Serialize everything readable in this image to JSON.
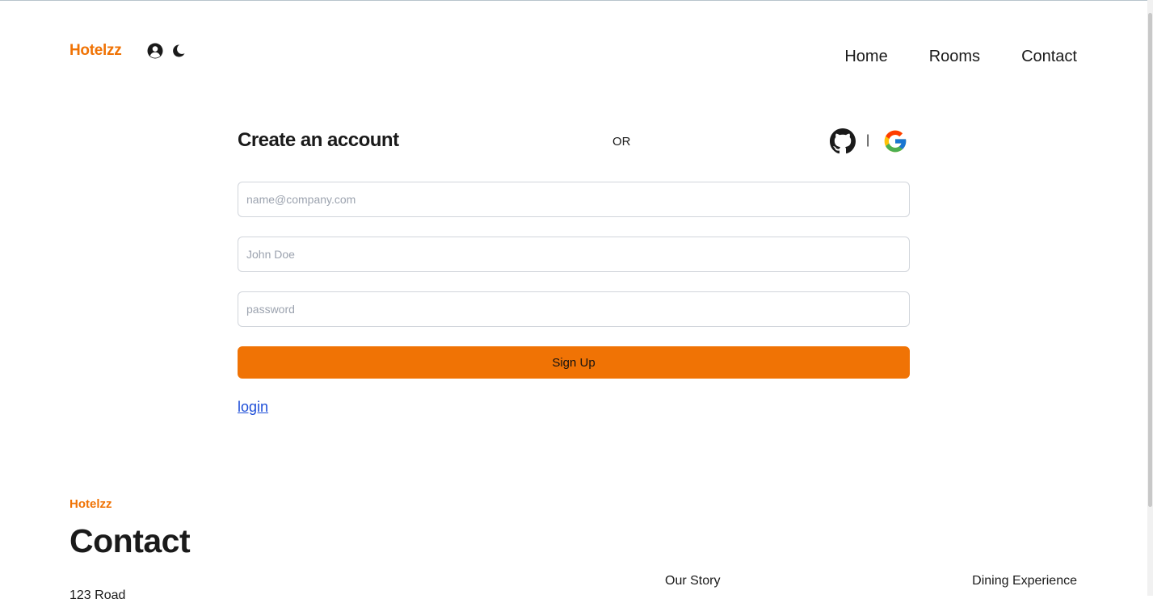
{
  "header": {
    "brand": "Hotelzz",
    "nav": [
      "Home",
      "Rooms",
      "Contact"
    ]
  },
  "signup": {
    "title": "Create an account",
    "or_label": "OR",
    "separator": "|",
    "email_placeholder": "name@company.com",
    "name_placeholder": "John Doe",
    "password_placeholder": "password",
    "submit_label": "Sign Up",
    "login_link": "login"
  },
  "footer": {
    "brand": "Hotelzz",
    "title": "Contact",
    "address_partial": "123 Road",
    "links": [
      "Our Story",
      "Dining Experience"
    ]
  },
  "icons": {
    "user": "user-circle-icon",
    "theme": "moon-icon",
    "github": "github-icon",
    "google": "google-icon"
  },
  "colors": {
    "accent": "#f07305",
    "link": "#1d4ed8",
    "text": "#1a1a1a",
    "border": "#d1d5db"
  }
}
